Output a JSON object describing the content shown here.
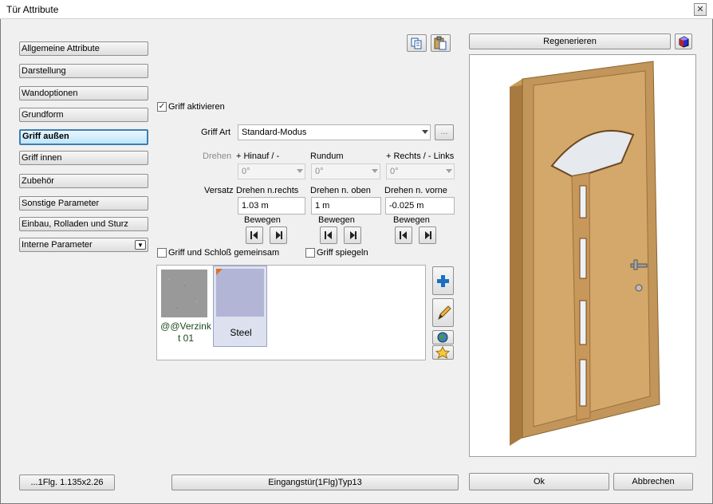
{
  "window": {
    "title": "Tür Attribute",
    "close": "✕"
  },
  "nav": {
    "items": [
      {
        "label": "Allgemeine Attribute"
      },
      {
        "label": "Darstellung"
      },
      {
        "label": "Wandoptionen"
      },
      {
        "label": "Grundform"
      },
      {
        "label": "Griff außen"
      },
      {
        "label": "Griff innen"
      },
      {
        "label": "Zubehör"
      },
      {
        "label": "Sonstige Parameter"
      },
      {
        "label": "Einbau, Rolladen und Sturz"
      }
    ],
    "dropdown_label": "Interne Parameter",
    "active": "Griff außen"
  },
  "griff": {
    "aktivieren_label": "Griff aktivieren",
    "aktivieren_checked": true,
    "art_label": "Griff Art",
    "art_value": "Standard-Modus",
    "ellipsis": "...",
    "drehen_label": "Drehen",
    "versatz_label": "Versatz",
    "bewegen_label": "Bewegen",
    "col1": {
      "drehen_header": "+ Hinauf / -",
      "drehen_value": "0°",
      "versatz_header": "Drehen n.rechts",
      "versatz_value": "1.03 m"
    },
    "col2": {
      "drehen_header": "Rundum",
      "drehen_value": "0°",
      "versatz_header": "Drehen n. oben",
      "versatz_value": "1 m"
    },
    "col3": {
      "drehen_header": "+ Rechts / - Links",
      "drehen_value": "0°",
      "versatz_header": "Drehen n. vorne",
      "versatz_value": "-0.025 m"
    },
    "gemeinsam_label": "Griff und Schloß gemeinsam",
    "gemeinsam_checked": false,
    "spiegeln_label": "Griff spiegeln",
    "spiegeln_checked": false
  },
  "materials": [
    {
      "name": "@@Verzink t 01",
      "swatch": "#9a9a9a",
      "selected": false
    },
    {
      "name": "Steel",
      "swatch": "#b2b5d6",
      "selected": true
    }
  ],
  "preview": {
    "regenerate_label": "Regenerieren"
  },
  "footer": {
    "size_label": "...1Flg. 1.135x2.26",
    "type_label": "Eingangstür(1Flg)Typ13",
    "ok_label": "Ok",
    "cancel_label": "Abbrechen"
  },
  "colors": {
    "door_wood": "#d4a86a",
    "frame_wood": "#b8894f",
    "glass": "#e6e9ee",
    "active_blue": "#3c7fb1"
  }
}
